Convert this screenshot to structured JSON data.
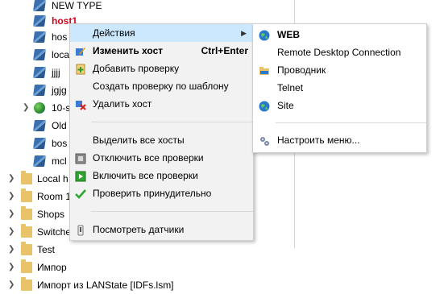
{
  "tree": {
    "items": [
      {
        "label": "NEW TYPE",
        "icon": "host-icon",
        "selected": false
      },
      {
        "label": "host1",
        "icon": "host-icon",
        "selected": true
      },
      {
        "label": "hos",
        "icon": "host-icon",
        "selected": false
      },
      {
        "label": "loca",
        "icon": "host-icon",
        "selected": false
      },
      {
        "label": "jjjj",
        "icon": "host-icon",
        "selected": false
      },
      {
        "label": "jgjg",
        "icon": "host-icon",
        "selected": false
      },
      {
        "label": "10-s",
        "icon": "globe-icon",
        "selected": false
      },
      {
        "label": "Old",
        "icon": "host-icon",
        "selected": false
      },
      {
        "label": "bos",
        "icon": "host-icon",
        "selected": false
      },
      {
        "label": "mcl",
        "icon": "host-icon",
        "selected": false
      },
      {
        "label": "Local h",
        "icon": "folder-icon",
        "selected": false
      },
      {
        "label": "Room 1",
        "icon": "folder-icon",
        "selected": false
      },
      {
        "label": "Shops",
        "icon": "folder-icon",
        "selected": false
      },
      {
        "label": "Switche",
        "icon": "folder-icon",
        "selected": false
      },
      {
        "label": "Test",
        "icon": "folder-icon",
        "selected": false
      },
      {
        "label": "Импор",
        "icon": "folder-icon",
        "selected": false
      },
      {
        "label": "Импорт из LANState [IDFs.lsm]",
        "icon": "folder-icon",
        "selected": false
      }
    ],
    "selected_color": "#d0021b"
  },
  "context_menu": {
    "items": [
      {
        "label": "Действия",
        "icon": "",
        "shortcut": "",
        "submenu": true,
        "bold": false,
        "highlighted": true
      },
      {
        "label": "Изменить хост",
        "icon": "edit-icon",
        "shortcut": "Ctrl+Enter",
        "submenu": false,
        "bold": true,
        "highlighted": false
      },
      {
        "label": "Добавить проверку",
        "icon": "add-check-icon",
        "shortcut": "",
        "submenu": false,
        "bold": false,
        "highlighted": false
      },
      {
        "label": "Создать проверку по шаблону",
        "icon": "",
        "shortcut": "",
        "submenu": false,
        "bold": false,
        "highlighted": false
      },
      {
        "label": "Удалить хост",
        "icon": "delete-icon",
        "shortcut": "",
        "submenu": false,
        "bold": false,
        "highlighted": false
      },
      {
        "label": "Выделить все хосты",
        "icon": "",
        "shortcut": "",
        "submenu": false,
        "bold": false,
        "highlighted": false
      },
      {
        "label": "Отключить все проверки",
        "icon": "disable-icon",
        "shortcut": "",
        "submenu": false,
        "bold": false,
        "highlighted": false
      },
      {
        "label": "Включить все проверки",
        "icon": "enable-icon",
        "shortcut": "",
        "submenu": false,
        "bold": false,
        "highlighted": false
      },
      {
        "label": "Проверить принудительно",
        "icon": "checkmark-icon",
        "shortcut": "",
        "submenu": false,
        "bold": false,
        "highlighted": false
      },
      {
        "label": "Посмотреть датчики",
        "icon": "sensor-icon",
        "shortcut": "",
        "submenu": false,
        "bold": false,
        "highlighted": false
      }
    ]
  },
  "submenu": {
    "items": [
      {
        "label": "WEB",
        "icon": "globe-icon",
        "bold": true
      },
      {
        "label": "Remote Desktop Connection",
        "icon": "",
        "bold": false
      },
      {
        "label": "Проводник",
        "icon": "folder-icon",
        "bold": false
      },
      {
        "label": "Telnet",
        "icon": "",
        "bold": false
      },
      {
        "label": "Site",
        "icon": "globe-icon",
        "bold": false
      },
      {
        "label": "Настроить меню...",
        "icon": "settings-icon",
        "bold": false
      }
    ],
    "highlight_color": "#cce8ff"
  }
}
